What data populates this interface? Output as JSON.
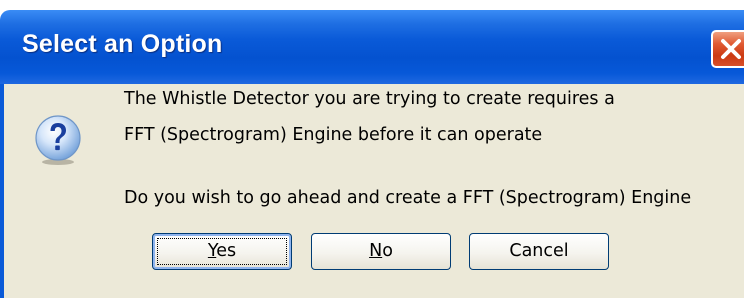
{
  "dialog": {
    "title": "Select an Option",
    "icon": "question-icon",
    "message_line1": "The Whistle Detector you are trying to create requires a",
    "message_line2": "FFT (Spectrogram) Engine before it can operate",
    "message_line3": "Do you wish to go ahead and create a FFT (Spectrogram) Engine",
    "buttons": {
      "yes_mnemonic": "Y",
      "yes_rest": "es",
      "no_mnemonic": "N",
      "no_rest": "o",
      "cancel": "Cancel"
    },
    "close_icon": "close-icon"
  },
  "colors": {
    "titlebar": "#0a5ad8",
    "dialog_background": "#ece9d8",
    "close_button": "#d8502a",
    "button_border": "#003c74"
  }
}
